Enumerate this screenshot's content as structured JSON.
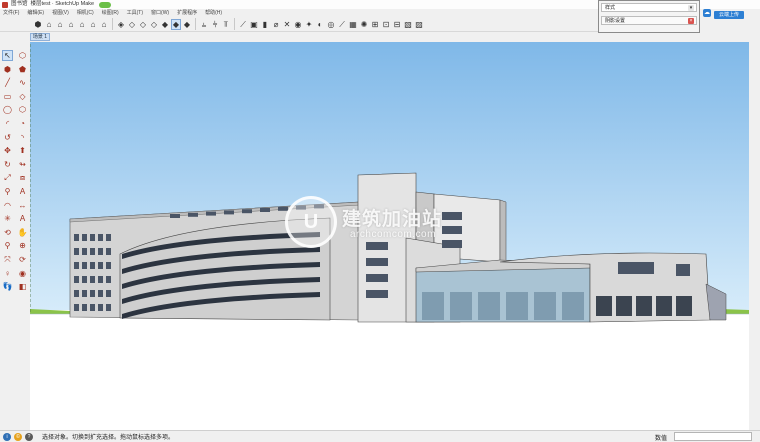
{
  "titlebar": {
    "doc": "图书馆",
    "app_title": "楼层test · SketchUp Make"
  },
  "menu": [
    "文件(F)",
    "编辑(E)",
    "视图(V)",
    "相机(C)",
    "绘图(R)",
    "工具(T)",
    "窗口(W)",
    "扩展程序",
    "帮助(H)"
  ],
  "toolbar_icons": [
    {
      "name": "component-icon",
      "glyph": "⬢"
    },
    {
      "name": "iso-view-icon",
      "glyph": "⌂"
    },
    {
      "name": "top-view-icon",
      "glyph": "⌂"
    },
    {
      "name": "front-view-icon",
      "glyph": "⌂"
    },
    {
      "name": "right-view-icon",
      "glyph": "⌂"
    },
    {
      "name": "back-view-icon",
      "glyph": "⌂"
    },
    {
      "name": "left-view-icon",
      "glyph": "⌂"
    },
    {
      "name": "sep"
    },
    {
      "name": "xray-icon",
      "glyph": "◈"
    },
    {
      "name": "back-edges-icon",
      "glyph": "◇"
    },
    {
      "name": "wireframe-icon",
      "glyph": "◇"
    },
    {
      "name": "hidden-line-icon",
      "glyph": "◇"
    },
    {
      "name": "shaded-icon",
      "glyph": "◆"
    },
    {
      "name": "shaded-textures-icon",
      "glyph": "◆",
      "on": true
    },
    {
      "name": "monochrome-icon",
      "glyph": "◆"
    },
    {
      "name": "sep"
    },
    {
      "name": "align-left-icon",
      "glyph": "⫨"
    },
    {
      "name": "align-center-icon",
      "glyph": "⫩"
    },
    {
      "name": "align-right-icon",
      "glyph": "⫪"
    },
    {
      "name": "sep"
    },
    {
      "name": "plugin-1-icon",
      "glyph": "⟋"
    },
    {
      "name": "plugin-2-icon",
      "glyph": "▣"
    },
    {
      "name": "plugin-3-icon",
      "glyph": "▮"
    },
    {
      "name": "plugin-4-icon",
      "glyph": "⌀"
    },
    {
      "name": "plugin-5-icon",
      "glyph": "✕"
    },
    {
      "name": "plugin-6-icon",
      "glyph": "◉"
    },
    {
      "name": "plugin-7-icon",
      "glyph": "✦"
    },
    {
      "name": "plugin-8-icon",
      "glyph": "◐"
    },
    {
      "name": "plugin-9-icon",
      "glyph": "◎"
    },
    {
      "name": "plugin-10-icon",
      "glyph": "⟋"
    },
    {
      "name": "plugin-11-icon",
      "glyph": "▦"
    },
    {
      "name": "plugin-12-icon",
      "glyph": "✺"
    },
    {
      "name": "plugin-13-icon",
      "glyph": "⊞"
    },
    {
      "name": "plugin-14-icon",
      "glyph": "⊡"
    },
    {
      "name": "plugin-15-icon",
      "glyph": "⊟"
    },
    {
      "name": "plugin-16-icon",
      "glyph": "▧"
    },
    {
      "name": "plugin-17-icon",
      "glyph": "▨"
    }
  ],
  "tray": {
    "row1": "样式",
    "row2": "阴影设置"
  },
  "upload": "云端上传",
  "scene_tab": "场景 1",
  "left_tools": [
    {
      "name": "select-icon",
      "glyph": "↖",
      "on": true
    },
    {
      "name": "eraser-icon",
      "glyph": "⬡"
    },
    {
      "name": "make-component-icon",
      "glyph": "⬢"
    },
    {
      "name": "paint-bucket-icon",
      "glyph": "⬟"
    },
    {
      "name": "line-icon",
      "glyph": "╱"
    },
    {
      "name": "freehand-icon",
      "glyph": "∿"
    },
    {
      "name": "rectangle-icon",
      "glyph": "▭"
    },
    {
      "name": "rotated-rect-icon",
      "glyph": "◇"
    },
    {
      "name": "circle-icon",
      "glyph": "◯"
    },
    {
      "name": "polygon-icon",
      "glyph": "⬡"
    },
    {
      "name": "arc-icon",
      "glyph": "◜"
    },
    {
      "name": "pie-icon",
      "glyph": "◔"
    },
    {
      "name": "arc3-icon",
      "glyph": "↺"
    },
    {
      "name": "arc2-icon",
      "glyph": "◝"
    },
    {
      "name": "move-icon",
      "glyph": "✥"
    },
    {
      "name": "push-pull-icon",
      "glyph": "⬆"
    },
    {
      "name": "rotate-icon",
      "glyph": "↻"
    },
    {
      "name": "follow-me-icon",
      "glyph": "↬"
    },
    {
      "name": "scale-icon",
      "glyph": "⤢"
    },
    {
      "name": "offset-icon",
      "glyph": "⧈"
    },
    {
      "name": "tape-measure-icon",
      "glyph": "⚲"
    },
    {
      "name": "text-icon",
      "glyph": "A"
    },
    {
      "name": "protractor-icon",
      "glyph": "◠"
    },
    {
      "name": "dimension-icon",
      "glyph": "↔"
    },
    {
      "name": "axes-icon",
      "glyph": "✳"
    },
    {
      "name": "3d-text-icon",
      "glyph": "A"
    },
    {
      "name": "orbit-icon",
      "glyph": "⟲"
    },
    {
      "name": "pan-icon",
      "glyph": "✋"
    },
    {
      "name": "zoom-icon",
      "glyph": "⚲"
    },
    {
      "name": "zoom-window-icon",
      "glyph": "⊕"
    },
    {
      "name": "zoom-extents-icon",
      "glyph": "⤧"
    },
    {
      "name": "previous-view-icon",
      "glyph": "⟳"
    },
    {
      "name": "position-camera-icon",
      "glyph": "♀"
    },
    {
      "name": "look-around-icon",
      "glyph": "◉"
    },
    {
      "name": "walk-icon",
      "glyph": "👣"
    },
    {
      "name": "section-plane-icon",
      "glyph": "◧"
    }
  ],
  "watermark": {
    "logo_letter": "U",
    "text": "建筑加油站",
    "sub": "archcomcom.com"
  },
  "status": {
    "message": "选择对象。切换到扩充选择。拖动鼠标选择多项。",
    "measure_label": "数值",
    "icons": [
      "info-icon",
      "credit-icon",
      "help-icon"
    ]
  },
  "colors": {
    "sky_top": "#7fb8e8",
    "sky_bottom": "#d7ecfa",
    "building": "#d9d9d9",
    "accent": "#2d7fd3"
  }
}
